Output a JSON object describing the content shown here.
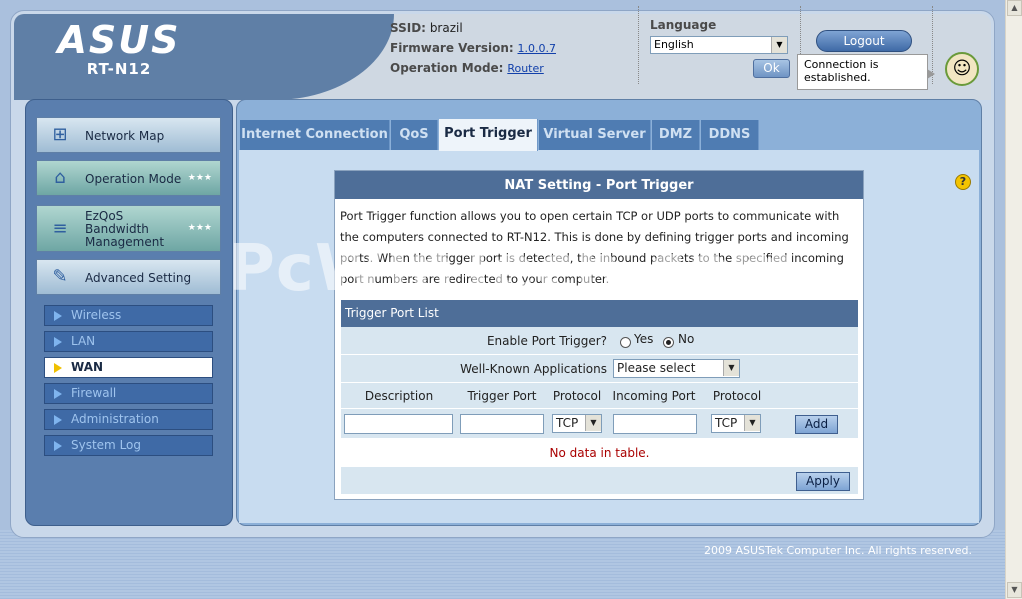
{
  "header": {
    "logo": "ASUS",
    "model": "RT-N12",
    "ssid_label": "SSID:",
    "ssid_value": "brazil",
    "firmware_label": "Firmware Version:",
    "firmware_value": "1.0.0.7",
    "mode_label": "Operation Mode:",
    "mode_value": "Router",
    "language_label": "Language",
    "language_value": "English",
    "ok_label": "Ok",
    "logout_label": "Logout",
    "status_text": "Connection is established."
  },
  "sidebar": {
    "main": [
      {
        "label": "Network Map",
        "icon": "network-map-icon"
      },
      {
        "label": "Operation Mode",
        "icon": "router-icon"
      },
      {
        "label": "EzQoS Bandwidth Management",
        "icon": "bandwidth-icon"
      },
      {
        "label": "Advanced Setting",
        "icon": "wrench-icon"
      }
    ],
    "sub": [
      {
        "label": "Wireless"
      },
      {
        "label": "LAN"
      },
      {
        "label": "WAN",
        "active": true
      },
      {
        "label": "Firewall"
      },
      {
        "label": "Administration"
      },
      {
        "label": "System Log"
      }
    ]
  },
  "tabs": [
    {
      "label": "Internet Connection"
    },
    {
      "label": "QoS"
    },
    {
      "label": "Port Trigger",
      "active": true
    },
    {
      "label": "Virtual Server"
    },
    {
      "label": "DMZ"
    },
    {
      "label": "DDNS"
    }
  ],
  "watermark": "PcWinTech.com",
  "panel": {
    "title": "NAT Setting - Port Trigger",
    "description": "Port Trigger function allows you to open certain TCP or UDP ports to communicate with the computers connected to RT-N12. This is done by defining trigger ports and incoming ports. When the trigger port is detected, the inbound packets to the specified incoming port numbers are redirected to your computer.",
    "list_title": "Trigger Port List",
    "enable_label": "Enable Port Trigger?",
    "yes_label": "Yes",
    "no_label": "No",
    "enable_value": "No",
    "apps_label": "Well-Known Applications",
    "apps_value": "Please select",
    "columns": [
      "Description",
      "Trigger Port",
      "Protocol",
      "Incoming Port",
      "Protocol"
    ],
    "trigger_protocol": "TCP",
    "incoming_protocol": "TCP",
    "add_label": "Add",
    "empty_text": "No data in table.",
    "apply_label": "Apply"
  },
  "footer": "2009 ASUSTek Computer Inc. All rights reserved.",
  "colors": {
    "accent": "#4e6e98",
    "empty_text": "#aa0000"
  }
}
